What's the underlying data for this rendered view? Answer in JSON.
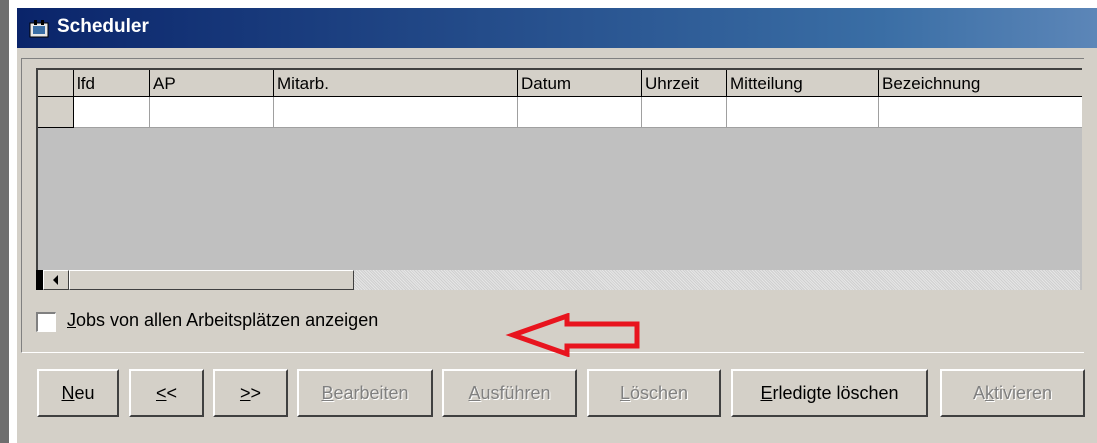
{
  "window": {
    "title": "Scheduler",
    "icon": "scheduler-app-icon"
  },
  "grid": {
    "columns": [
      "lfd",
      "AP",
      "Mitarb.",
      "Datum",
      "Uhrzeit",
      "Mitteilung",
      "Bezeichnung"
    ],
    "rows": [
      [
        "",
        "",
        "",
        "",
        "",
        "",
        ""
      ]
    ]
  },
  "options": {
    "all_workplaces_checkbox": {
      "label_accel": "J",
      "label_rest": "obs von allen Arbeitsplätzen anzeigen",
      "checked": false
    }
  },
  "annotation": {
    "arrow_color": "#e8141e"
  },
  "buttons": {
    "neu": {
      "accel": "N",
      "rest": "eu",
      "enabled": true
    },
    "prev": {
      "accel": "<",
      "rest": "<",
      "enabled": true
    },
    "next": {
      "accel": ">",
      "rest": ">",
      "enabled": true
    },
    "bearbeiten": {
      "accel": "B",
      "rest": "earbeiten",
      "enabled": false
    },
    "ausfuehren": {
      "accel": "A",
      "rest": "usführen",
      "enabled": false
    },
    "loeschen": {
      "accel": "L",
      "rest": "öschen",
      "enabled": false
    },
    "erledigte": {
      "accel": "E",
      "rest": "rledigte löschen",
      "enabled": true
    },
    "aktivieren": {
      "pre": "A",
      "accel": "k",
      "rest": "tivieren",
      "enabled": false
    }
  }
}
